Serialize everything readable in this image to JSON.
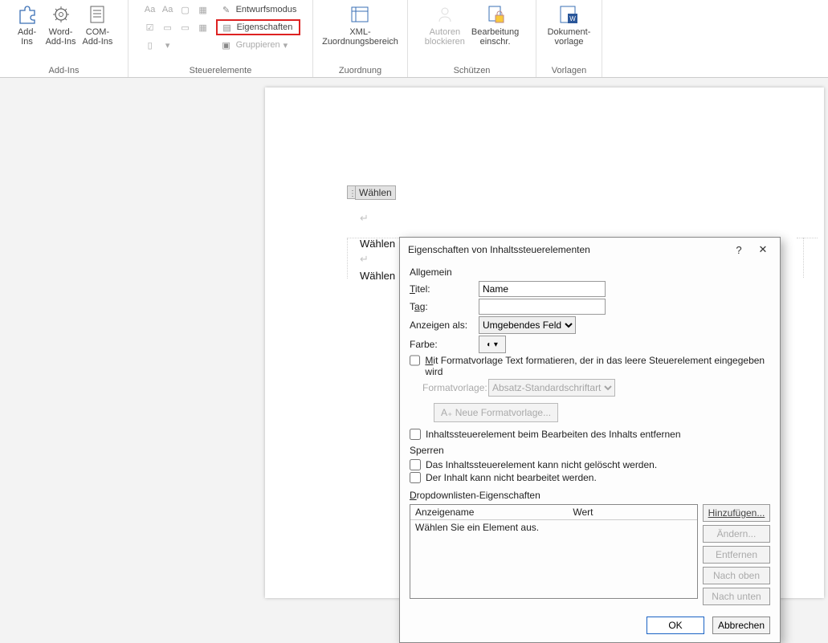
{
  "ribbon": {
    "addins": {
      "label": "Add-Ins",
      "btn1": "Add-\nIns",
      "btn2": "Word-\nAdd-Ins",
      "btn3": "COM-\nAdd-Ins"
    },
    "steuer": {
      "label": "Steuerelemente",
      "entwurf": "Entwurfsmodus",
      "eigenschaften": "Eigenschaften",
      "gruppieren": "Gruppieren"
    },
    "zuord": {
      "label": "Zuordnung",
      "btn": "XML-\nZuordnungsbereich"
    },
    "schutz": {
      "label": "Schützen",
      "b1": "Autoren\nblockieren",
      "b2": "Bearbeitung\neinschr."
    },
    "vorlage": {
      "label": "Vorlagen",
      "btn": "Dokument-\nvorlage"
    }
  },
  "doc": {
    "cc": "Wählen",
    "l1": "Wählen",
    "l2": "Wählen"
  },
  "dialog": {
    "title": "Eigenschaften von Inhaltssteuerelementen",
    "allgemein": "Allgemein",
    "titel_lbl": "Titel:",
    "titel_val": "Name",
    "tag_lbl": "Tag:",
    "tag_val": "",
    "anzeigen_lbl": "Anzeigen als:",
    "anzeigen_val": "Umgebendes Feld",
    "farbe_lbl": "Farbe:",
    "chk_format": "Mit Formatvorlage Text formatieren, der in das leere Steuerelement eingegeben wird",
    "formatvorlage_lbl": "Formatvorlage:",
    "formatvorlage_val": "Absatz-Standardschriftart",
    "newstyle": "Neue Formatvorlage...",
    "chk_remove": "Inhaltssteuerelement beim Bearbeiten des Inhalts entfernen",
    "sperren": "Sperren",
    "chk_lock1": "Das Inhaltssteuerelement kann nicht gelöscht werden.",
    "chk_lock2": "Der Inhalt kann nicht bearbeitet werden.",
    "dd_title": "Dropdownlisten-Eigenschaften",
    "col_name": "Anzeigename",
    "col_wert": "Wert",
    "row1": "Wählen Sie ein Element aus.",
    "btn_add": "Hinzufügen...",
    "btn_edit": "Ändern...",
    "btn_remove": "Entfernen",
    "btn_up": "Nach oben",
    "btn_down": "Nach unten",
    "ok": "OK",
    "cancel": "Abbrechen"
  }
}
